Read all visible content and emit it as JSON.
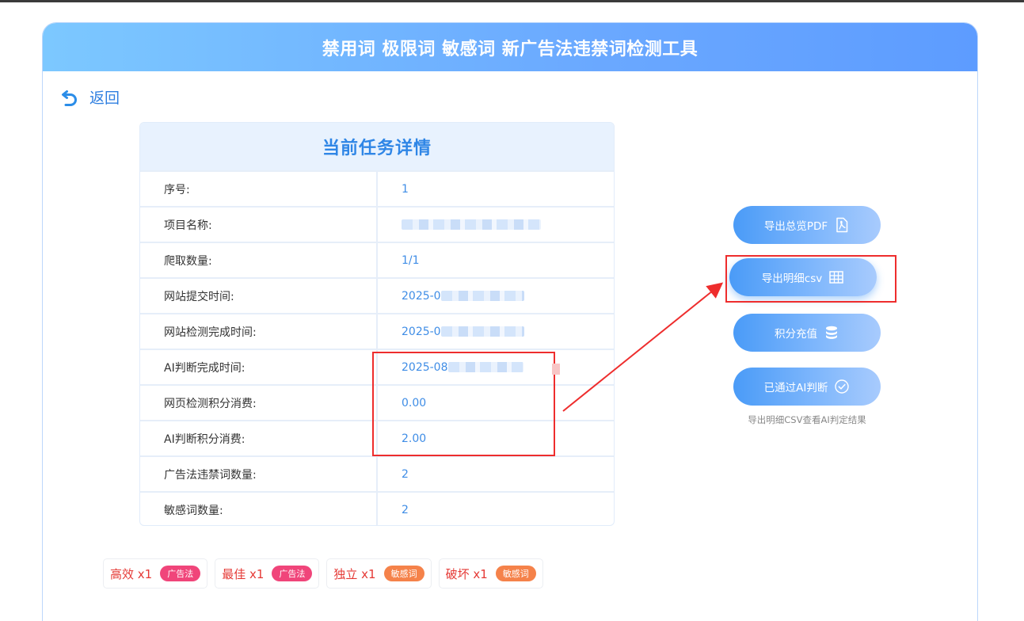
{
  "header": {
    "title": "禁用词 极限词 敏感词 新广告法违禁词检测工具"
  },
  "nav": {
    "back_label": "返回",
    "back_icon": "undo-arrow-icon"
  },
  "task": {
    "title": "当前任务详情",
    "rows": [
      {
        "label": "序号:",
        "value": "1"
      },
      {
        "label": "项目名称:",
        "value": ""
      },
      {
        "label": "爬取数量:",
        "value": "1/1"
      },
      {
        "label": "网站提交时间:",
        "value": "2025-0"
      },
      {
        "label": "网站检测完成时间:",
        "value": "2025-0"
      },
      {
        "label": "AI判断完成时间:",
        "value": "2025-08"
      },
      {
        "label": "网页检测积分消费:",
        "value": "0.00"
      },
      {
        "label": "AI判断积分消费:",
        "value": "2.00"
      },
      {
        "label": "广告法违禁词数量:",
        "value": "2"
      },
      {
        "label": "敏感词数量:",
        "value": "2"
      }
    ]
  },
  "actions": {
    "export_pdf": "导出总览PDF",
    "export_csv": "导出明细csv",
    "recharge": "积分充值",
    "ai_passed": "已通过AI判断",
    "hint": "导出明细CSV查看AI判定结果"
  },
  "icons": {
    "pdf": "pdf-file-icon",
    "csv": "table-grid-icon",
    "recharge": "database-coins-icon",
    "ai_passed": "check-circle-icon"
  },
  "tags": [
    {
      "word": "高效 x1",
      "badge": "广告法",
      "badge_color": "#f0457a"
    },
    {
      "word": "最佳 x1",
      "badge": "广告法",
      "badge_color": "#f0457a"
    },
    {
      "word": "独立 x1",
      "badge": "敏感词",
      "badge_color": "#f5824a"
    },
    {
      "word": "破坏 x1",
      "badge": "敏感词",
      "badge_color": "#f5824a"
    }
  ],
  "colors": {
    "accent": "#3f8de6",
    "highlight": "#ee2d2d",
    "header_start": "#7cc8ff",
    "header_end": "#5d9cff"
  }
}
